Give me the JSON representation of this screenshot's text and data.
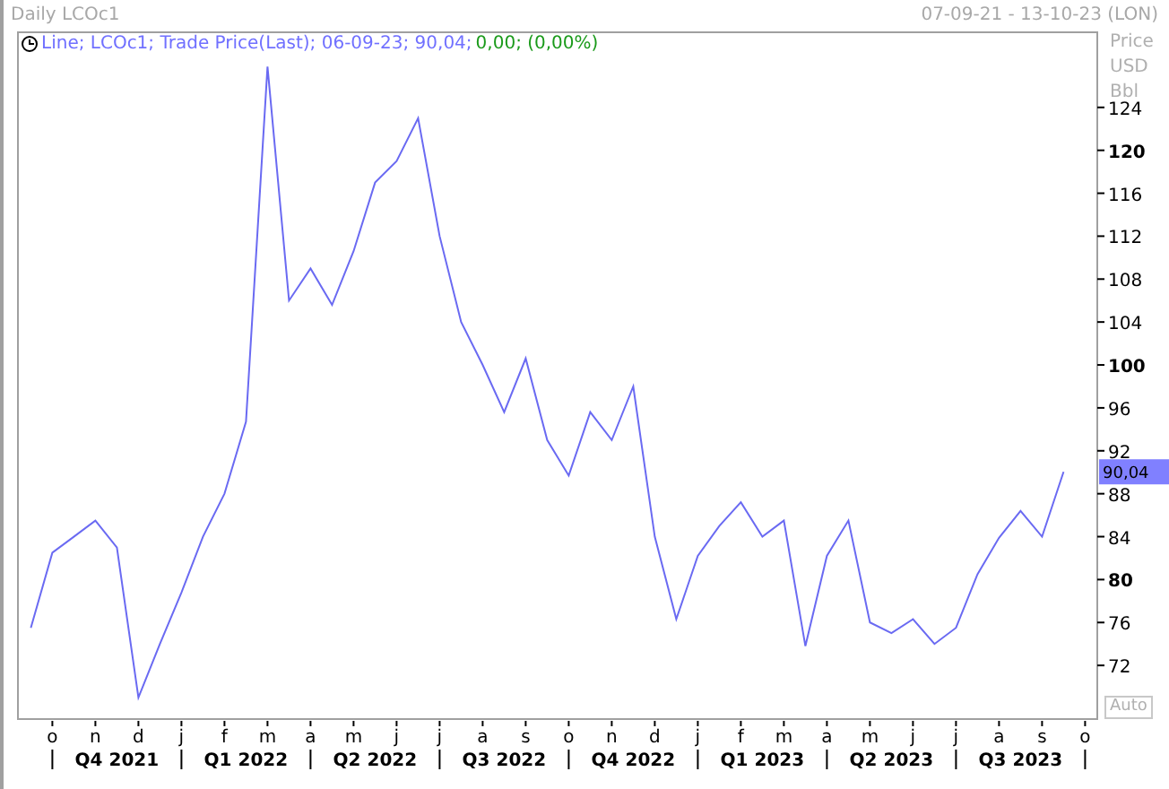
{
  "header": {
    "title": "Daily LCOc1",
    "range": "07-09-21 - 13-10-23 (LON)"
  },
  "legend": {
    "series_text": "Line; LCOc1; Trade Price(Last); 06-09-23; 90,04;",
    "change_text": "0,00; (0,00%)"
  },
  "axis_units": [
    "Price",
    "USD",
    "Bbl"
  ],
  "last_value": "90,04",
  "auto_button": "Auto",
  "quarters": [
    {
      "label": "Q4 2021"
    },
    {
      "label": "Q1 2022"
    },
    {
      "label": "Q2 2022"
    },
    {
      "label": "Q3 2022"
    },
    {
      "label": "Q4 2022"
    },
    {
      "label": "Q1 2023"
    },
    {
      "label": "Q2 2023"
    },
    {
      "label": "Q3 2023"
    }
  ],
  "chart_data": {
    "type": "line",
    "ylim": [
      67,
      131
    ],
    "yticks": [
      72,
      76,
      80,
      84,
      88,
      92,
      96,
      100,
      104,
      108,
      112,
      116,
      120,
      124
    ],
    "categories": [
      null,
      "o",
      null,
      "n",
      null,
      "d",
      null,
      "j",
      null,
      "f",
      null,
      "m",
      null,
      "a",
      null,
      "m",
      null,
      "j",
      null,
      "j",
      null,
      "a",
      null,
      "s",
      null,
      "o",
      null,
      "n",
      null,
      "d",
      null,
      "j",
      null,
      "f",
      null,
      "m",
      null,
      "a",
      null,
      "m",
      null,
      "j",
      null,
      "j",
      null,
      "a",
      null,
      "s",
      null,
      "o"
    ],
    "series": [
      {
        "color": "#6a6af2",
        "values": [
          75.5,
          82.5,
          84,
          85.5,
          83,
          69,
          74,
          78.8,
          84,
          88,
          94.7,
          127.8,
          106,
          109,
          105.6,
          110.6,
          117,
          119,
          123,
          112,
          104,
          100,
          95.6,
          100.6,
          93,
          89.7,
          95.6,
          93,
          98,
          84,
          76.3,
          82.2,
          85,
          87.2,
          84,
          85.5,
          73.8,
          82.2,
          85.5,
          76,
          75,
          76.3,
          74,
          75.5,
          80.5,
          83.9,
          86.4,
          84,
          90.04,
          null
        ]
      }
    ]
  }
}
